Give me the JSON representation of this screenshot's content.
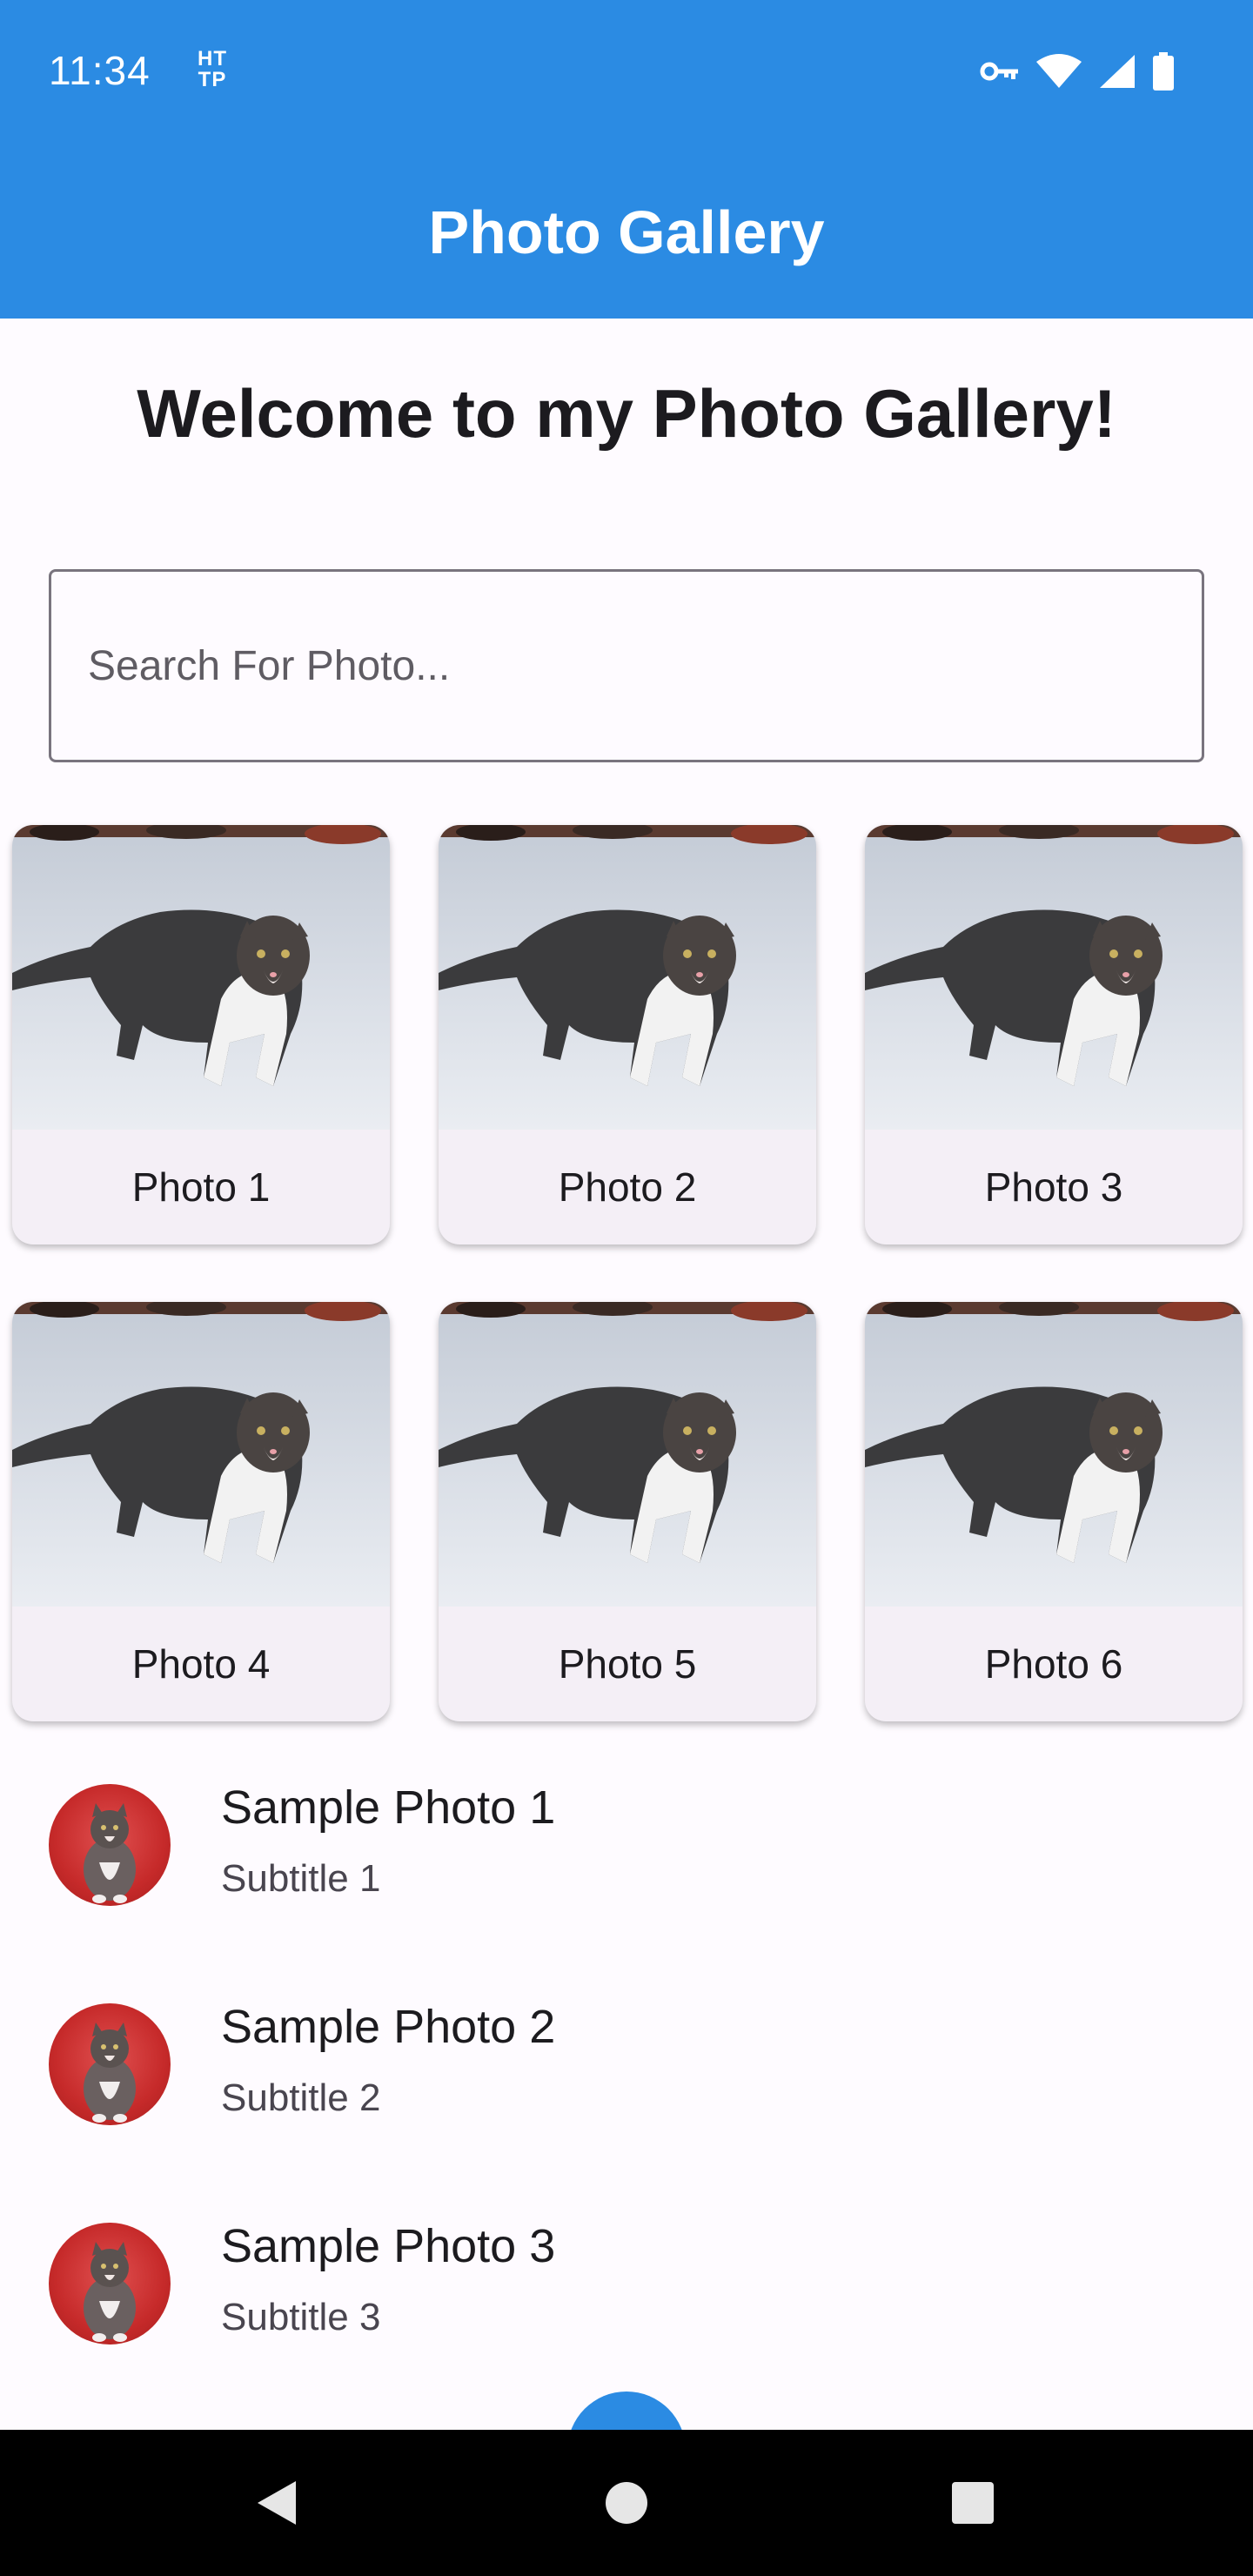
{
  "status_bar": {
    "time": "11:34",
    "http_icon": "HTTP",
    "icons": [
      "vpn-key-icon",
      "wifi-icon",
      "signal-icon",
      "battery-icon"
    ]
  },
  "app_bar": {
    "title": "Photo Gallery",
    "color": "#2b8be3"
  },
  "welcome": "Welcome to my Photo Gallery!",
  "search": {
    "placeholder": "Search For Photo..."
  },
  "photos": [
    {
      "label": "Photo 1"
    },
    {
      "label": "Photo 2"
    },
    {
      "label": "Photo 3"
    },
    {
      "label": "Photo 4"
    },
    {
      "label": "Photo 5"
    },
    {
      "label": "Photo 6"
    }
  ],
  "list": [
    {
      "title": "Sample Photo 1",
      "subtitle": "Subtitle 1"
    },
    {
      "title": "Sample Photo 2",
      "subtitle": "Subtitle 2"
    },
    {
      "title": "Sample Photo 3",
      "subtitle": "Subtitle 3"
    }
  ],
  "nav": {
    "icons": [
      "back-icon",
      "home-icon",
      "recents-icon"
    ]
  }
}
